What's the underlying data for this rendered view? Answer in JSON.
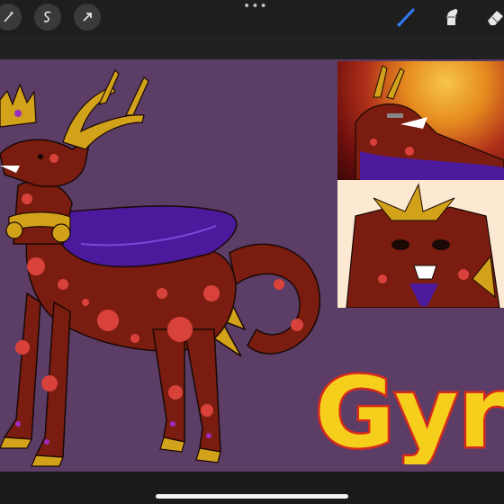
{
  "app": {
    "overflow_label": "•••"
  },
  "toolbar": {
    "left_tools": [
      {
        "icon": "magic-wand-icon",
        "name": "adjustments-tool"
      },
      {
        "icon": "s-selection-icon",
        "name": "selection-tool"
      },
      {
        "icon": "arrow-cursor-icon",
        "name": "transform-tool"
      }
    ],
    "right_tools": [
      {
        "icon": "brush-icon",
        "name": "brush-tool",
        "active": true
      },
      {
        "icon": "smudge-icon",
        "name": "smudge-tool"
      },
      {
        "icon": "eraser-icon",
        "name": "eraser-tool"
      }
    ],
    "accent_color": "#2e7cf6"
  },
  "artwork": {
    "title_text": "Gyr",
    "colors": {
      "background": "#5b3d66",
      "body": "#7a1d10",
      "spots": "#d9423a",
      "antlers": "#d2a21b",
      "cape": "#4b1a9c",
      "title_fill": "#f6cf1c",
      "title_outline": "#d42a1e"
    }
  }
}
